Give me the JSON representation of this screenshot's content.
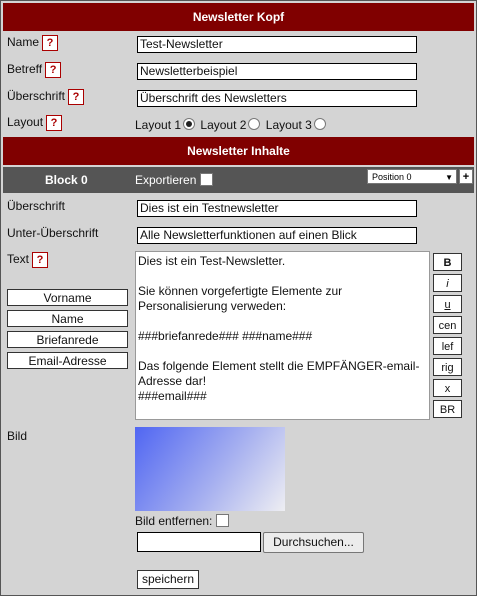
{
  "header": {
    "title": "Newsletter Kopf"
  },
  "fields": {
    "name": {
      "label": "Name",
      "value": "Test-Newsletter"
    },
    "betreff": {
      "label": "Betreff",
      "value": "Newsletterbeispiel"
    },
    "ueberschrift": {
      "label": "Überschrift",
      "value": "Überschrift des Newsletters"
    },
    "layout": {
      "label": "Layout",
      "options": [
        "Layout 1",
        "Layout 2",
        "Layout 3"
      ],
      "selected": "Layout 1"
    }
  },
  "help_glyph": "?",
  "content_bar": {
    "title": "Newsletter Inhalte"
  },
  "block": {
    "name": "Block 0",
    "export_label": "Exportieren",
    "position_select": "Position 0",
    "add_label": "+",
    "ueberschrift": {
      "label": "Überschrift",
      "value": "Dies ist ein Testnewsletter"
    },
    "unterueberschrift": {
      "label": "Unter-Überschrift",
      "value": "Alle Newsletterfunktionen auf einen Blick"
    },
    "text": {
      "label": "Text",
      "value": "Dies ist ein Test-Newsletter.\n\nSie können vorgefertigte Elemente zur Personalisierung verweden:\n\n###briefanrede### ###name###\n\nDas folgende Element stellt die EMPFÄNGER-email-Adresse dar!\n###email###"
    },
    "format_buttons": [
      "B",
      "i",
      "u",
      "cen",
      "lef",
      "rig",
      "x",
      "BR"
    ],
    "variables": [
      "Vorname",
      "Name",
      "Briefanrede",
      "Email-Adresse"
    ],
    "bild": {
      "label": "Bild",
      "remove_label": "Bild entfernen:",
      "browse_label": "Durchsuchen..."
    },
    "save_label": "speichern"
  },
  "colors": {
    "accent": "#800000",
    "block_bar": "#555555",
    "background": "#d4d4d4"
  }
}
